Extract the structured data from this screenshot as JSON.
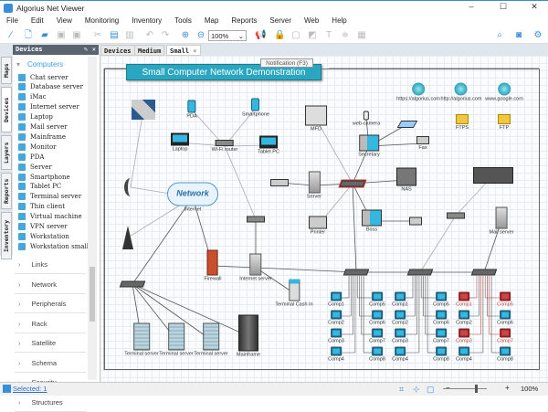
{
  "window": {
    "title": "Algorius Net Viewer",
    "minimize": "–",
    "maximize": "☐",
    "close": "✕"
  },
  "menu": [
    "File",
    "Edit",
    "View",
    "Monitoring",
    "Inventory",
    "Tools",
    "Map",
    "Reports",
    "Server",
    "Web",
    "Help"
  ],
  "toolbar": {
    "zoom_value": "100%",
    "zoom_arrow": "⌄",
    "icons": [
      "wand-icon",
      "new-icon",
      "open-icon",
      "save-icon",
      "save-all-icon",
      "cut-icon",
      "copy-icon",
      "paste-icon",
      "undo-icon",
      "redo-icon",
      "zoom-in-icon",
      "zoom-out-icon"
    ],
    "right_icons": [
      "search-icon",
      "camera-icon",
      "gear-icon"
    ]
  },
  "tabs": [
    {
      "label": "Devices",
      "active": false
    },
    {
      "label": "Medium",
      "active": false
    },
    {
      "label": "Small",
      "active": true
    }
  ],
  "tab_close": "×",
  "side_tabs": [
    "Maps",
    "Devices",
    "Layers",
    "Reports",
    "Inventory"
  ],
  "panel": {
    "title": "Devices",
    "pin": "✎",
    "close": "✕",
    "open_group": "Computers",
    "items": [
      "Chat server",
      "Database server",
      "iMac",
      "Internet server",
      "Laptop",
      "Mail server",
      "Mainframe",
      "Monitor",
      "PDA",
      "Server",
      "Smartphone",
      "Tablet PC",
      "Terminal server",
      "Thin client",
      "Virtual machine",
      "VPN server",
      "Workstation",
      "Workstation small"
    ],
    "groups": [
      "Links",
      "Network",
      "Peripherals",
      "Rack",
      "Satellite",
      "Schema",
      "Security",
      "Structures"
    ]
  },
  "diagram": {
    "title": "Small Computer Network Demonstration",
    "tooltip": "Notification (F3)",
    "nodes": [
      {
        "id": "satellite",
        "label": "",
        "type": "sat"
      },
      {
        "id": "pda",
        "label": "PDA",
        "type": "ph"
      },
      {
        "id": "smartphone",
        "label": "Smartphone",
        "type": "ph"
      },
      {
        "id": "laptop",
        "label": "Laptop",
        "type": "lap"
      },
      {
        "id": "wifi",
        "label": "Wi-Fi router",
        "type": "router"
      },
      {
        "id": "tablet",
        "label": "Tablet PC",
        "type": "lap"
      },
      {
        "id": "mfd",
        "label": "MFD",
        "type": "mfd"
      },
      {
        "id": "webcam",
        "label": "web-camera",
        "type": "cam"
      },
      {
        "id": "scanner",
        "label": "",
        "type": "scan"
      },
      {
        "id": "secretary",
        "label": "Secretary",
        "type": "pc"
      },
      {
        "id": "fax",
        "label": "Fax",
        "type": "tel"
      },
      {
        "id": "https",
        "label": "https://algorius.com",
        "type": "globe"
      },
      {
        "id": "http",
        "label": "http://algorius.com",
        "type": "globe"
      },
      {
        "id": "google",
        "label": "www.google.com",
        "type": "globe"
      },
      {
        "id": "ftps",
        "label": "FTPS",
        "type": "fold"
      },
      {
        "id": "ftp",
        "label": "FTP",
        "type": "fold"
      },
      {
        "id": "dish",
        "label": "",
        "type": "dish"
      },
      {
        "id": "network",
        "label": "Internet",
        "type": "cloud",
        "text": "Network"
      },
      {
        "id": "projector",
        "label": "",
        "type": "proj"
      },
      {
        "id": "server",
        "label": "Server",
        "type": "srv"
      },
      {
        "id": "hub",
        "label": "",
        "type": "sw redb"
      },
      {
        "id": "nas",
        "label": "NAS",
        "type": "nas"
      },
      {
        "id": "plotter",
        "label": "",
        "type": "plot"
      },
      {
        "id": "printer",
        "label": "Printer",
        "type": "prn"
      },
      {
        "id": "boss",
        "label": "Boss",
        "type": "pc"
      },
      {
        "id": "phone",
        "label": "",
        "type": "tel"
      },
      {
        "id": "ap2",
        "label": "",
        "type": "router"
      },
      {
        "id": "mailserver",
        "label": "Mail server",
        "type": "srv"
      },
      {
        "id": "tower",
        "label": "",
        "type": "tower"
      },
      {
        "id": "ap1",
        "label": "",
        "type": "router"
      },
      {
        "id": "firewall",
        "label": "Firewall",
        "type": "fw"
      },
      {
        "id": "inetserver",
        "label": "Internet server",
        "type": "srv"
      },
      {
        "id": "cashin",
        "label": "Terminal Cash In",
        "type": "kiosk"
      },
      {
        "id": "switch0",
        "label": "",
        "type": "sw"
      },
      {
        "id": "ts1",
        "label": "Terminal server",
        "type": "tsrv"
      },
      {
        "id": "ts2",
        "label": "Terminal server",
        "type": "tsrv"
      },
      {
        "id": "ts3",
        "label": "Terminal server",
        "type": "tsrv"
      },
      {
        "id": "mainframe",
        "label": "Mainframe",
        "type": "mf"
      },
      {
        "id": "switch1",
        "label": "",
        "type": "sw"
      },
      {
        "id": "switch2",
        "label": "",
        "type": "sw"
      },
      {
        "id": "switch3",
        "label": "",
        "type": "sw"
      }
    ],
    "comp_groups": [
      {
        "comps": [
          {
            "label": "Comp1",
            "alert": false
          },
          {
            "label": "Comp2",
            "alert": false
          },
          {
            "label": "Comp3",
            "alert": false
          },
          {
            "label": "Comp4",
            "alert": false
          },
          {
            "label": "Comp5",
            "alert": false
          },
          {
            "label": "Comp6",
            "alert": false
          },
          {
            "label": "Comp7",
            "alert": false
          },
          {
            "label": "Comp8",
            "alert": false
          }
        ]
      },
      {
        "comps": [
          {
            "label": "Comp1",
            "alert": false
          },
          {
            "label": "Comp2",
            "alert": false
          },
          {
            "label": "Comp3",
            "alert": false
          },
          {
            "label": "Comp4",
            "alert": false
          },
          {
            "label": "Comp5",
            "alert": false
          },
          {
            "label": "Comp6",
            "alert": false
          },
          {
            "label": "Comp7",
            "alert": false
          },
          {
            "label": "Comp8",
            "alert": false
          }
        ]
      },
      {
        "comps": [
          {
            "label": "Comp1",
            "alert": true
          },
          {
            "label": "Comp2",
            "alert": false
          },
          {
            "label": "Comp3",
            "alert": true
          },
          {
            "label": "Comp4",
            "alert": false
          },
          {
            "label": "Comp5",
            "alert": true
          },
          {
            "label": "Comp6",
            "alert": false
          },
          {
            "label": "Comp7",
            "alert": true
          },
          {
            "label": "Comp8",
            "alert": false
          }
        ]
      }
    ]
  },
  "status": {
    "selected": "Selected: 1",
    "zoom": "100%",
    "zoom_level_percent": 100,
    "minus": "−",
    "plus": "+"
  },
  "colors": {
    "accent": "#2aa6c0",
    "alert": "#cc4444",
    "link_ok": "#4caf50"
  }
}
